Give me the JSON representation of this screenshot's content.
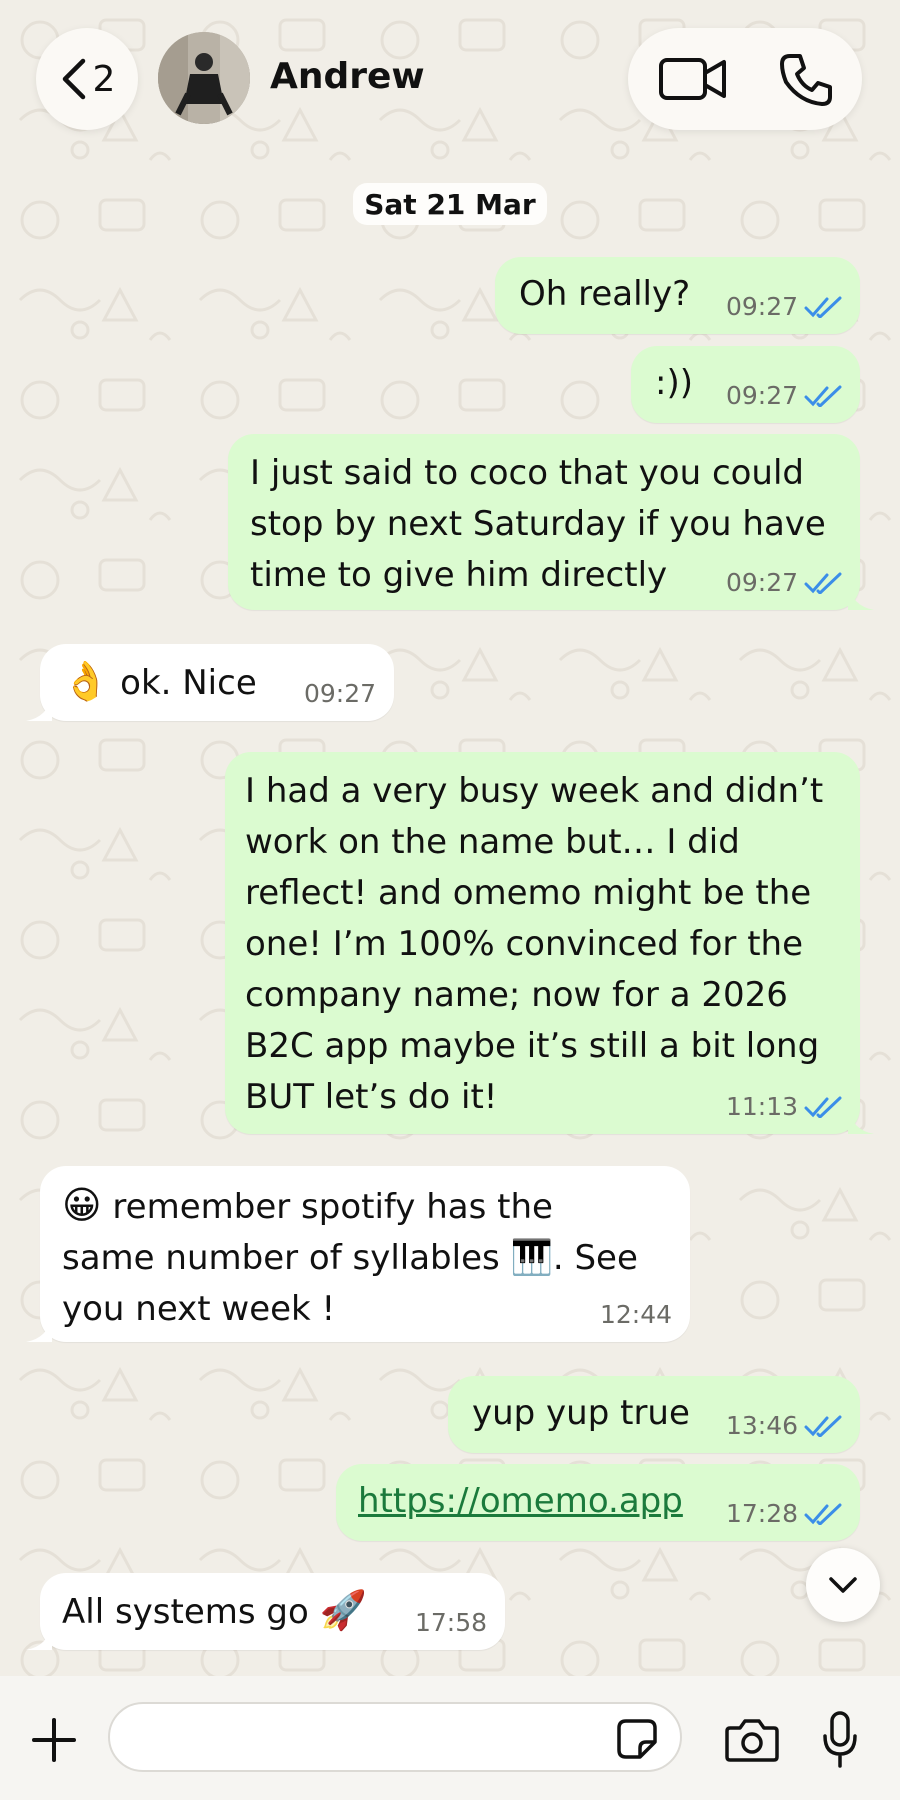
{
  "header": {
    "back_count": "2",
    "contact_name": "Andrew"
  },
  "date_separator": "Sat 21 Mar",
  "messages": [
    {
      "direction": "out",
      "text": "Oh really?",
      "time": "09:27",
      "status": "read"
    },
    {
      "direction": "out",
      "text": ":))",
      "time": "09:27",
      "status": "read"
    },
    {
      "direction": "out",
      "text": "I just said to coco that you could\nstop by next Saturday if you have\ntime to give him directly",
      "time": "09:27",
      "status": "read"
    },
    {
      "direction": "in",
      "emoji": "👌",
      "text": "ok. Nice",
      "time": "09:27"
    },
    {
      "direction": "out",
      "text": "I had a very busy week and didn’t\nwork on the name but… I did\nreflect! and omemo might be the\none! I’m 100% convinced for the\ncompany name; now for a 2026\nB2C app maybe it’s still a bit long\nBUT let’s do it!",
      "time": "11:13",
      "status": "read"
    },
    {
      "direction": "in",
      "emoji": "😀",
      "text": " remember spotify has the\nsame number of syllables 🎹. See\nyou next week !",
      "time": "12:44"
    },
    {
      "direction": "out",
      "text": "yup yup true",
      "time": "13:46",
      "status": "read"
    },
    {
      "direction": "out",
      "link": "https://omemo.app",
      "time": "17:28",
      "status": "read"
    },
    {
      "direction": "in",
      "text": "All systems go ",
      "emoji": "🚀",
      "time": "17:58"
    }
  ],
  "composer": {
    "value": "",
    "placeholder": ""
  },
  "colors": {
    "outgoing_bubble": "#dbfbd0",
    "incoming_bubble": "#ffffff",
    "read_ticks": "#3b8ee8",
    "background": "#f1eee7"
  },
  "icons": [
    "chevron-left-icon",
    "video-camera-icon",
    "phone-icon",
    "chevron-down-icon",
    "plus-icon",
    "sticker-icon",
    "camera-icon",
    "microphone-icon",
    "double-check-icon"
  ]
}
